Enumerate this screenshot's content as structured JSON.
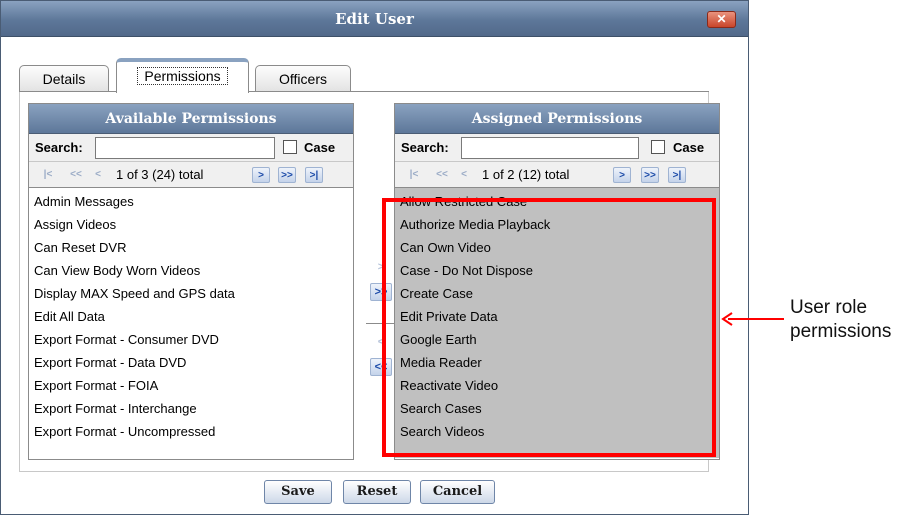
{
  "window": {
    "title": "Edit User",
    "close_label": "✕"
  },
  "tabs": [
    {
      "label": "Details",
      "active": false
    },
    {
      "label": "Permissions",
      "active": true
    },
    {
      "label": "Officers",
      "active": false
    }
  ],
  "available": {
    "header": "Available Permissions",
    "search_label": "Search:",
    "search_value": "",
    "case_label": "Case",
    "case_checked": false,
    "pager": {
      "first": "|<",
      "prev_page": "<<",
      "prev": "<",
      "text": "1 of 3 (24) total",
      "next": ">",
      "next_page": ">>",
      "last": ">|"
    },
    "items": [
      "Admin Messages",
      "Assign Videos",
      "Can Reset DVR",
      "Can View Body Worn Videos",
      "Display MAX Speed and GPS data",
      "Edit All Data",
      "Export Format - Consumer DVD",
      "Export Format - Data DVD",
      "Export Format - FOIA",
      "Export Format - Interchange",
      "Export Format - Uncompressed"
    ]
  },
  "assigned": {
    "header": "Assigned Permissions",
    "search_label": "Search:",
    "search_value": "",
    "case_label": "Case",
    "case_checked": false,
    "pager": {
      "first": "|<",
      "prev_page": "<<",
      "prev": "<",
      "text": "1 of 2 (12) total",
      "next": ">",
      "next_page": ">>",
      "last": ">|"
    },
    "items": [
      "Allow Restricted Case",
      "Authorize Media Playback",
      "Can Own Video",
      "Case - Do Not Dispose",
      "Create Case",
      "Edit Private Data",
      "Google Earth",
      "Media Reader",
      "Reactivate Video",
      "Search Cases",
      "Search Videos"
    ]
  },
  "transfer": {
    "add": ">",
    "add_all": ">>",
    "remove": "<",
    "remove_all": "<<"
  },
  "footer": {
    "save": "Save",
    "reset": "Reset",
    "cancel": "Cancel"
  },
  "annotation": {
    "line1": "User role",
    "line2": "permissions",
    "color": "#ff0000"
  },
  "colors": {
    "header": "#5d7799",
    "highlight": "#ff0000",
    "assigned_bg": "#c0c0c0"
  }
}
